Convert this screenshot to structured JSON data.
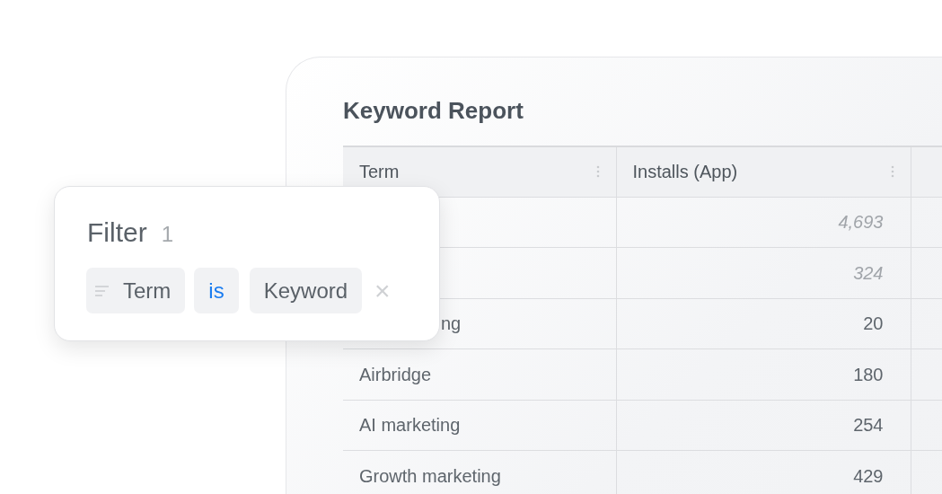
{
  "report": {
    "title": "Keyword Report",
    "columns": [
      {
        "label": "Term"
      },
      {
        "label": "Installs (App)"
      }
    ],
    "rows": [
      {
        "installs": "4,693",
        "estimated": true
      },
      {
        "installs": "324",
        "estimated": true
      },
      {
        "term": "ng",
        "covered": true,
        "installs": "20",
        "estimated": false
      },
      {
        "term": "Airbridge",
        "installs": "180",
        "estimated": false
      },
      {
        "term": "AI marketing",
        "installs": "254",
        "estimated": false
      },
      {
        "term": "Growth marketing",
        "installs": "429",
        "estimated": false
      }
    ]
  },
  "filter": {
    "title": "Filter",
    "count": "1",
    "field": "Term",
    "operator": "is",
    "value": "Keyword",
    "remove": "×"
  }
}
